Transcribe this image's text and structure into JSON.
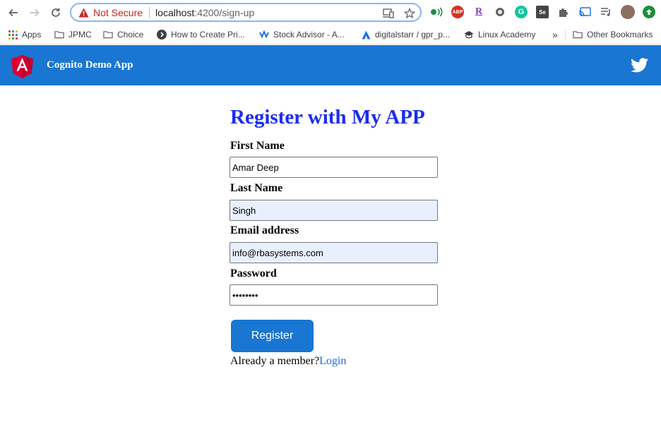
{
  "browser": {
    "address_bar": {
      "security_label": "Not Secure",
      "host": "localhost",
      "path": ":4200/sign-up"
    },
    "extensions": [
      {
        "name": "abp",
        "text": "ABP",
        "color": "#d93025"
      },
      {
        "name": "r",
        "text": "R",
        "color": "#7b3fbf"
      },
      {
        "name": "grammarly",
        "text": "G",
        "color": "#15c39a"
      },
      {
        "name": "selenium",
        "text": "Se",
        "color": "#444444"
      }
    ],
    "bookmarks": [
      {
        "label": "Apps",
        "icon": "apps-grid-icon"
      },
      {
        "label": "JPMC",
        "icon": "folder-icon"
      },
      {
        "label": "Choice",
        "icon": "folder-icon"
      },
      {
        "label": "How to Create Pri...",
        "icon": "site-icon"
      },
      {
        "label": "Stock Advisor - A...",
        "icon": "site-icon"
      },
      {
        "label": "digitalstarr / gpr_p...",
        "icon": "site-icon"
      },
      {
        "label": "Linux Academy",
        "icon": "site-icon"
      }
    ],
    "more_bookmarks": "»",
    "other_bookmarks": "Other Bookmarks"
  },
  "app": {
    "title": "Cognito Demo App",
    "brand_color": "#1976d2"
  },
  "form": {
    "heading": "Register with My APP",
    "fields": [
      {
        "label": "First Name",
        "value": "Amar Deep",
        "type": "text"
      },
      {
        "label": "Last Name",
        "value": "Singh",
        "type": "text"
      },
      {
        "label": "Email address",
        "value": "info@rbasystems.com",
        "type": "email"
      },
      {
        "label": "Password",
        "value": "Password",
        "type": "password"
      }
    ],
    "submit_label": "Register",
    "member_text": "Already a member?",
    "login_link": "Login"
  }
}
